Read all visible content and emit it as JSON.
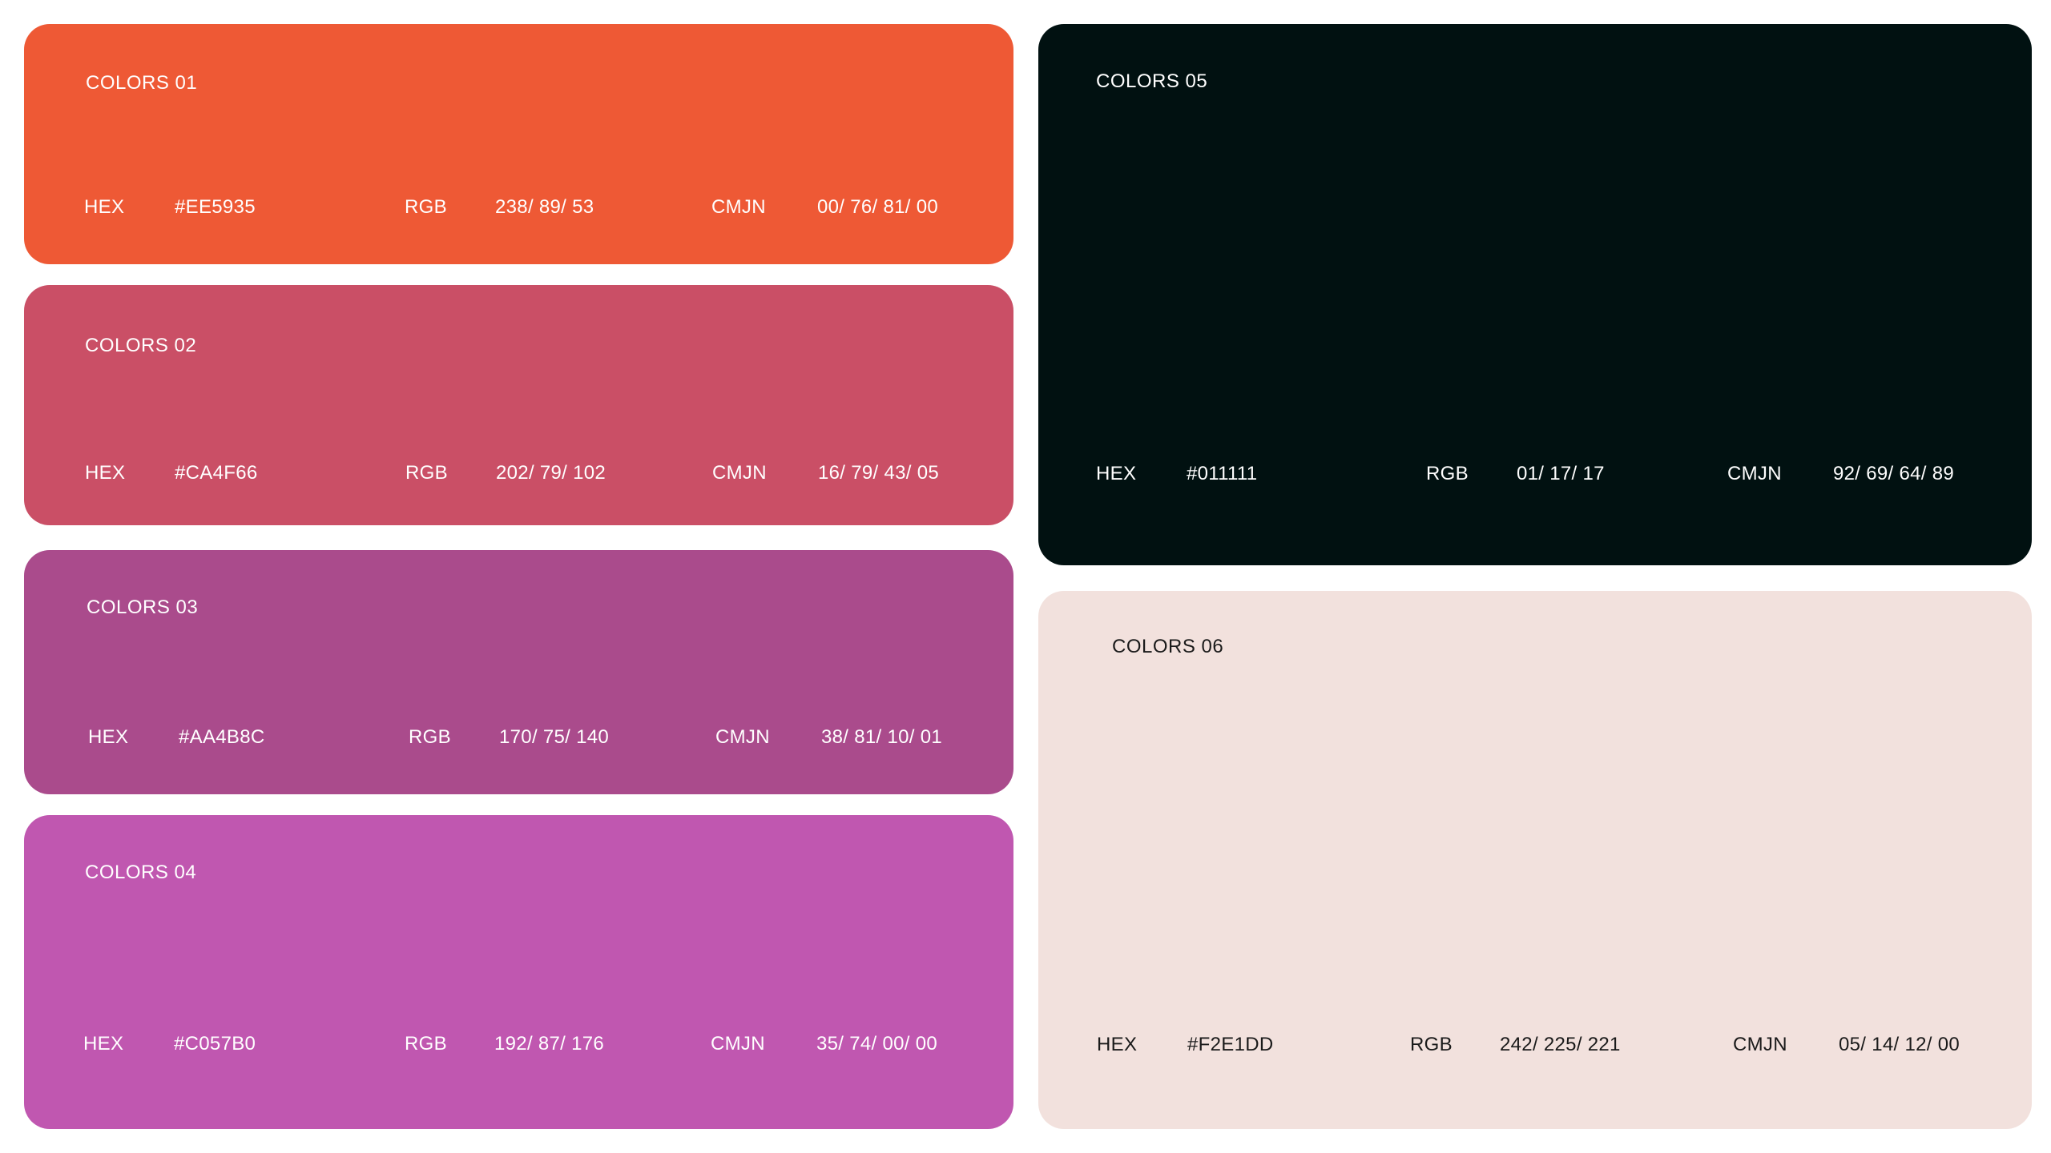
{
  "palette": [
    {
      "title": "COLORS 01",
      "hex_label": "HEX",
      "hex": "#EE5935",
      "rgb_label": "RGB",
      "rgb": "238/ 89/ 53",
      "cmjn_label": "CMJN",
      "cmjn": "00/ 76/ 81/ 00",
      "color": "#EE5935",
      "text_color": "#FFFFFF"
    },
    {
      "title": "COLORS 02",
      "hex_label": "HEX",
      "hex": "#CA4F66",
      "rgb_label": "RGB",
      "rgb": "202/ 79/ 102",
      "cmjn_label": "CMJN",
      "cmjn": "16/ 79/ 43/ 05",
      "color": "#CA4F66",
      "text_color": "#FFFFFF"
    },
    {
      "title": "COLORS 03",
      "hex_label": "HEX",
      "hex": "#AA4B8C",
      "rgb_label": "RGB",
      "rgb": "170/ 75/ 140",
      "cmjn_label": "CMJN",
      "cmjn": "38/ 81/ 10/ 01",
      "color": "#AA4B8C",
      "text_color": "#FFFFFF"
    },
    {
      "title": "COLORS 04",
      "hex_label": "HEX",
      "hex": "#C057B0",
      "rgb_label": "RGB",
      "rgb": "192/ 87/ 176",
      "cmjn_label": "CMJN",
      "cmjn": "35/ 74/ 00/ 00",
      "color": "#C057B0",
      "text_color": "#FFFFFF"
    },
    {
      "title": "COLORS 05",
      "hex_label": "HEX",
      "hex": "#011111",
      "rgb_label": "RGB",
      "rgb": "01/ 17/ 17",
      "cmjn_label": "CMJN",
      "cmjn": "92/ 69/ 64/ 89",
      "color": "#011111",
      "text_color": "#FFFFFF"
    },
    {
      "title": "COLORS 06",
      "hex_label": "HEX",
      "hex": "#F2E1DD",
      "rgb_label": "RGB",
      "rgb": "242/ 225/ 221",
      "cmjn_label": "CMJN",
      "cmjn": "05/ 14/ 12/ 00",
      "color": "#F2E1DD",
      "text_color": "#1A1A1A"
    }
  ]
}
